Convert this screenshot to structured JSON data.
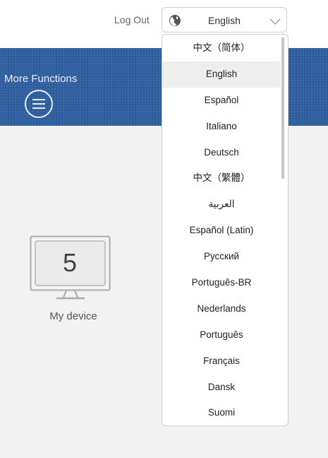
{
  "header": {
    "logout_label": "Log Out",
    "language_select": {
      "value": "English",
      "icon": "globe-icon"
    }
  },
  "banner": {
    "title": "More Functions",
    "menu_icon": "hamburger-menu-icon"
  },
  "device": {
    "count": "5",
    "label": "My device",
    "icon": "monitor-icon"
  },
  "language_dropdown": {
    "selected": "English",
    "options": [
      "中文（简体）",
      "English",
      "Español",
      "Italiano",
      "Deutsch",
      "中文（繁體）",
      "العربية",
      "Español (Latin)",
      "Русский",
      "Português-BR",
      "Nederlands",
      "Português",
      "Français",
      "Dansk",
      "Suomi"
    ]
  },
  "colors": {
    "banner": "#2f5d9e",
    "background": "#f2f2f2",
    "selected_option": "#eeeeee"
  }
}
